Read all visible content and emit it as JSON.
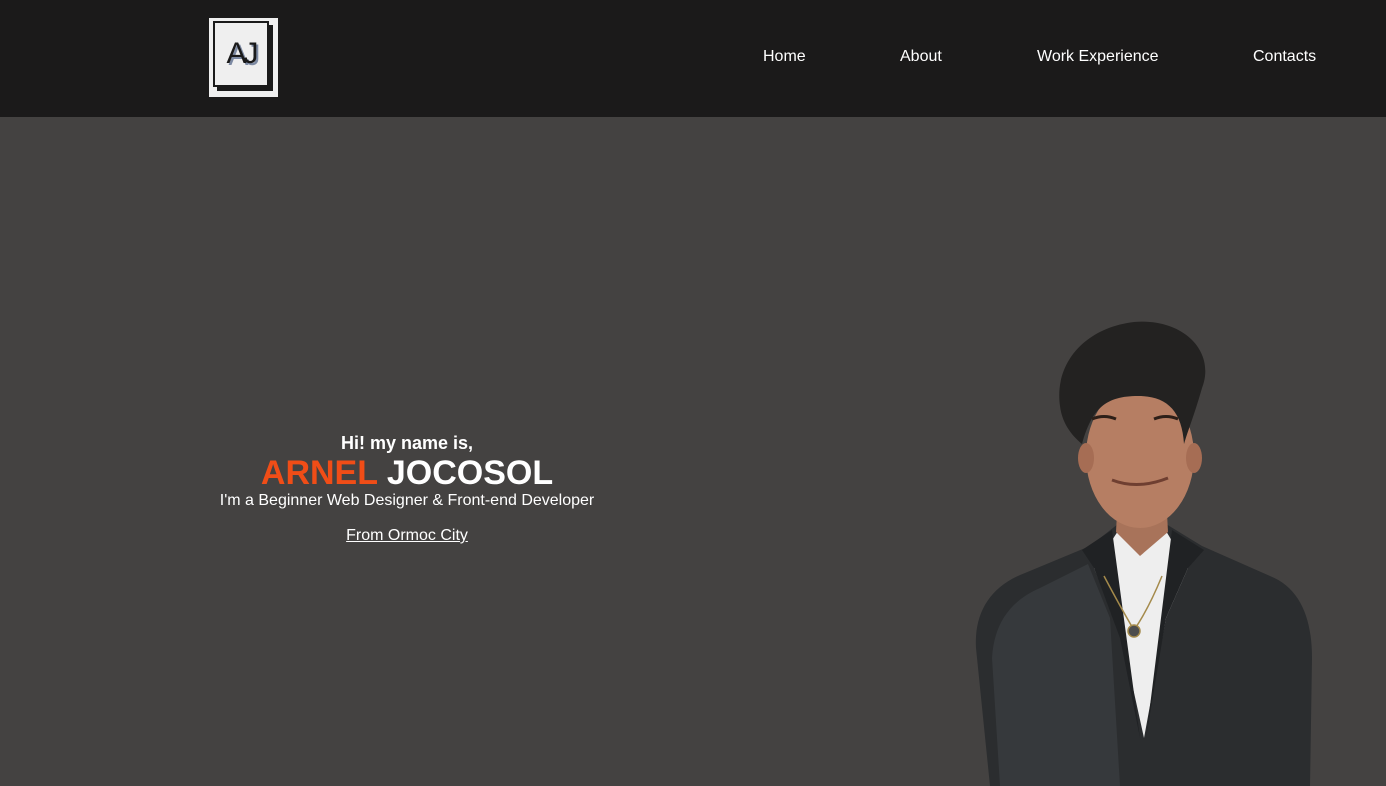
{
  "header": {
    "logo_text": "AJ",
    "nav": {
      "home": "Home",
      "about": "About",
      "work_experience": "Work Experience",
      "contacts": "Contacts"
    }
  },
  "hero": {
    "greeting": "Hi! my name is,",
    "first_name": "ARNEL",
    "last_name": "JOCOSOL",
    "tagline": "I'm a Beginner Web Designer & Front-end Developer",
    "location_link": "From Ormoc City"
  },
  "colors": {
    "navbar_bg": "#1b1a1a",
    "page_bg": "#444241",
    "accent": "#f04d17",
    "text": "#ffffff"
  },
  "icons": {
    "logo": "aj-logo-icon",
    "portrait": "profile-photo"
  }
}
